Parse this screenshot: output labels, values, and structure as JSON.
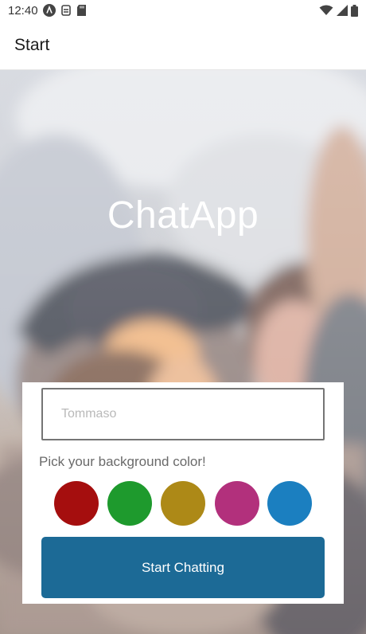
{
  "status_bar": {
    "time": "12:40",
    "left_icons": [
      "android-studio-icon",
      "sim-alert-icon",
      "sd-card-icon"
    ],
    "right_icons": [
      "wifi-icon",
      "signal-icon",
      "battery-icon"
    ]
  },
  "header": {
    "title": "Start"
  },
  "hero": {
    "title": "ChatApp"
  },
  "form": {
    "name_placeholder": "Tommaso",
    "name_value": "",
    "pick_label": "Pick your background color!",
    "swatches": [
      {
        "color": "#a50e0e"
      },
      {
        "color": "#1e9a2d"
      },
      {
        "color": "#ad8917"
      },
      {
        "color": "#b2307c"
      },
      {
        "color": "#1b7fc0"
      }
    ],
    "start_button_label": "Start Chatting"
  }
}
